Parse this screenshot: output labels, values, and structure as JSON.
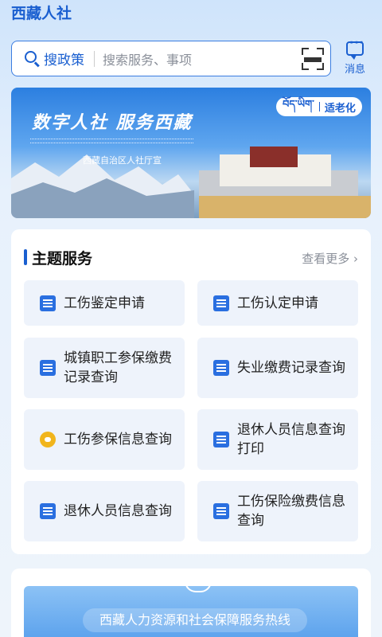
{
  "app": {
    "title": "西藏人社"
  },
  "search": {
    "keyword": "搜政策",
    "placeholder": "搜索服务、事项"
  },
  "header": {
    "message_label": "消息"
  },
  "banner": {
    "slogan": "数字人社 服务西藏",
    "org": "西藏自治区人社厅宣",
    "elder_mode_tibetan": "བོད་ཡིག་",
    "elder_mode_label": "适老化"
  },
  "theme_services": {
    "title": "主题服务",
    "see_more": "查看更多 ›",
    "items": [
      {
        "label": "工伤鉴定申请",
        "icon": "document-icon"
      },
      {
        "label": "工伤认定申请",
        "icon": "form-icon"
      },
      {
        "label": "城镇职工参保缴费记录查询",
        "icon": "record-icon"
      },
      {
        "label": "失业缴费记录查询",
        "icon": "receipt-icon"
      },
      {
        "label": "工伤参保信息查询",
        "icon": "heart-hand-icon"
      },
      {
        "label": "退休人员信息查询打印",
        "icon": "id-card-icon"
      },
      {
        "label": "退休人员信息查询",
        "icon": "badge-icon"
      },
      {
        "label": "工伤保险缴费信息查询",
        "icon": "edit-doc-icon"
      }
    ]
  },
  "hotline": {
    "title": "西藏人力资源和社会保障服务热线"
  },
  "colors": {
    "brand": "#1a5fd0",
    "tile_bg": "#eef3fb",
    "icon_gold": "#f1b51c"
  }
}
